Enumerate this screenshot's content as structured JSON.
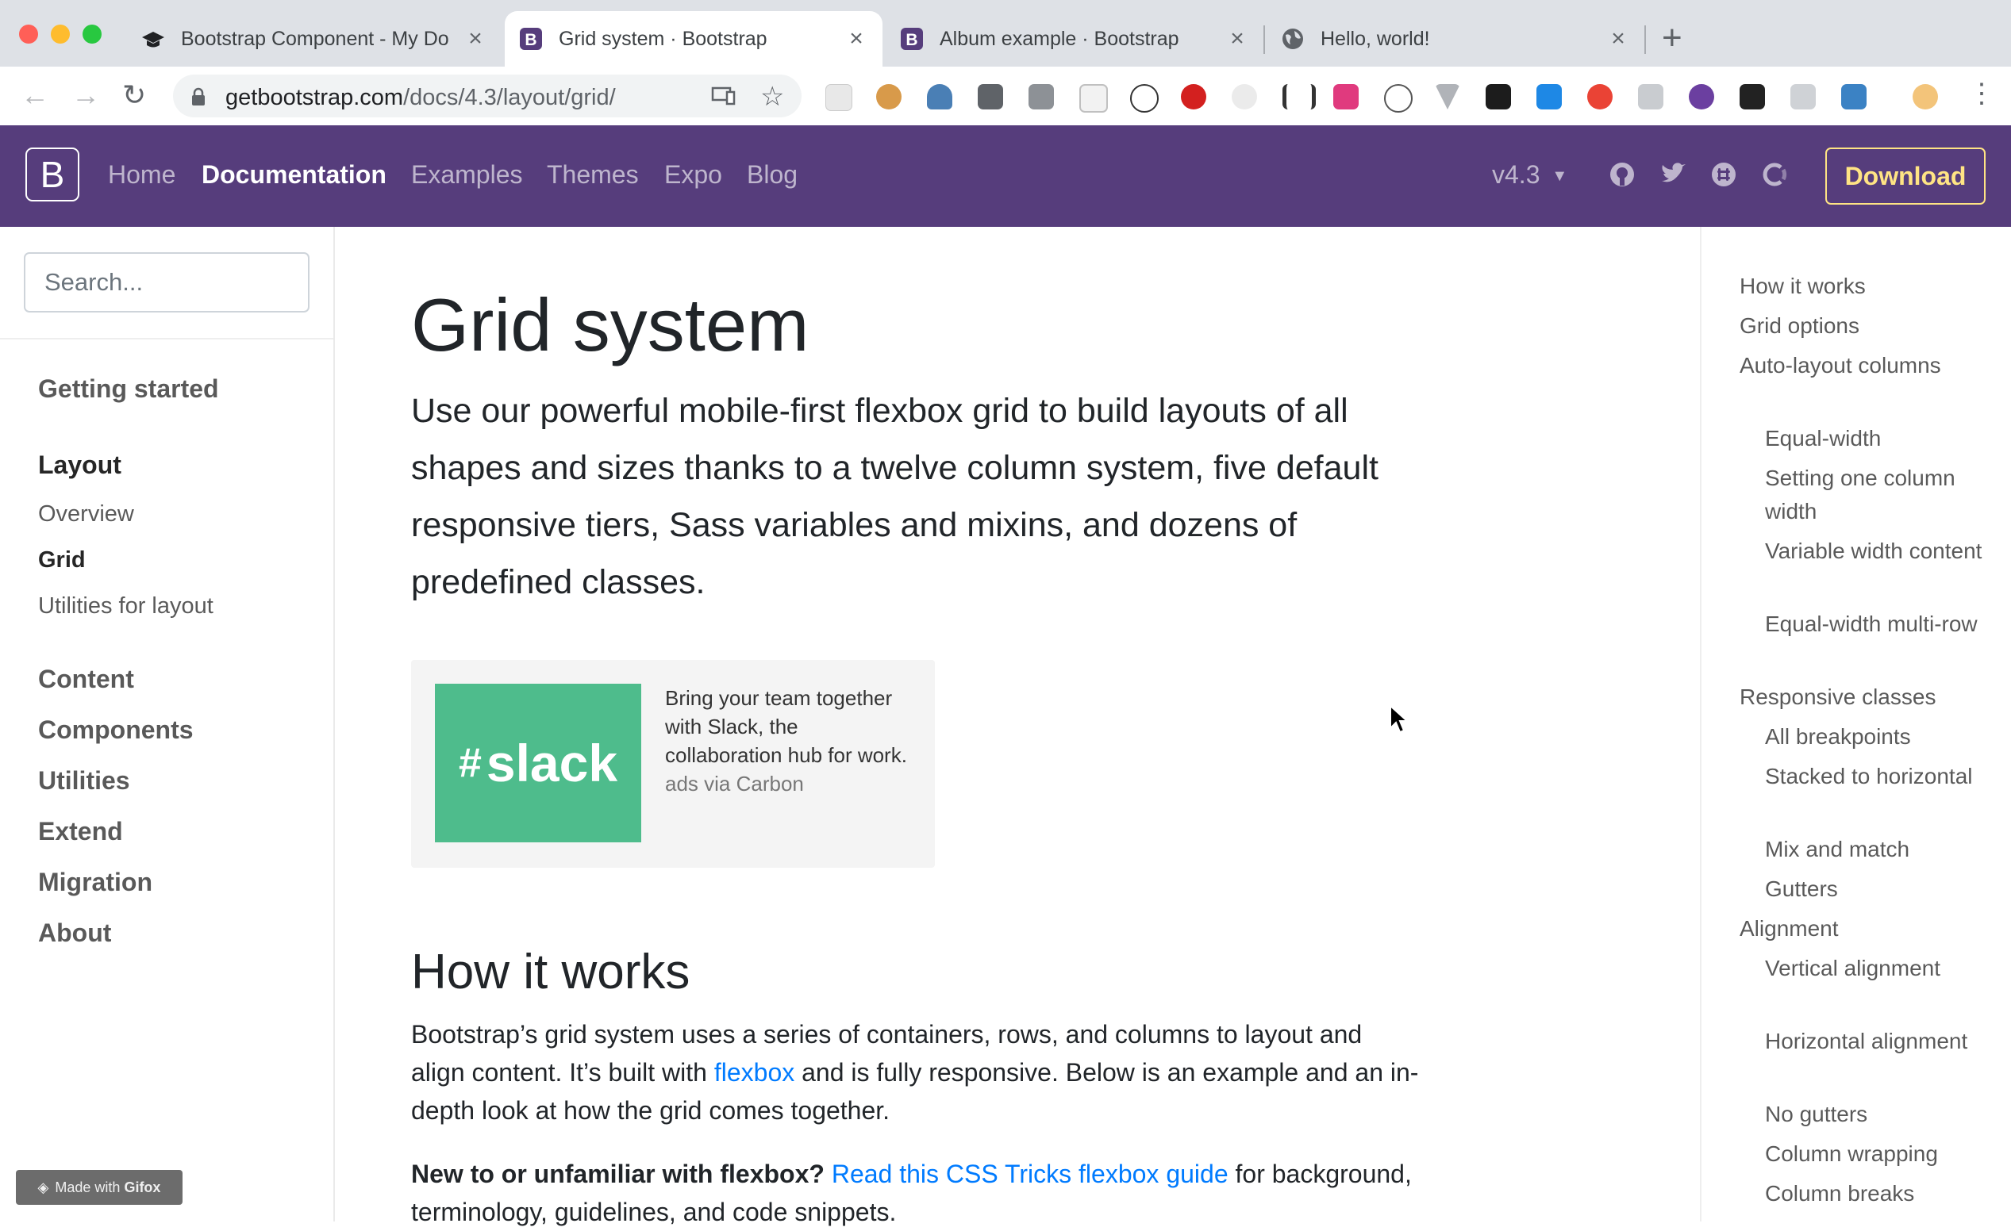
{
  "browser": {
    "tabs": [
      {
        "title": "Bootstrap Component - My Do",
        "icon": "graduation-cap-icon",
        "active": false
      },
      {
        "title": "Grid system · Bootstrap",
        "icon": "bootstrap-icon",
        "active": true
      },
      {
        "title": "Album example · Bootstrap",
        "icon": "bootstrap-icon",
        "active": false
      },
      {
        "title": "Hello, world!",
        "icon": "globe-icon",
        "active": false
      }
    ],
    "url_host": "getbootstrap.com",
    "url_path": "/docs/4.3/layout/grid/"
  },
  "navbar": {
    "brand": "B",
    "links": [
      "Home",
      "Documentation",
      "Examples",
      "Themes",
      "Expo",
      "Blog"
    ],
    "active_link": "Documentation",
    "version": "v4.3",
    "download": "Download"
  },
  "sidebar": {
    "search_placeholder": "Search...",
    "sections": [
      {
        "label": "Getting started"
      },
      {
        "label": "Layout",
        "active": true,
        "items": [
          {
            "label": "Overview"
          },
          {
            "label": "Grid",
            "active": true
          },
          {
            "label": "Utilities for layout"
          }
        ]
      },
      {
        "label": "Content"
      },
      {
        "label": "Components"
      },
      {
        "label": "Utilities"
      },
      {
        "label": "Extend"
      },
      {
        "label": "Migration"
      },
      {
        "label": "About"
      }
    ]
  },
  "main": {
    "title": "Grid system",
    "lead": "Use our powerful mobile-first flexbox grid to build layouts of all shapes and sizes thanks to a twelve column system, five default responsive tiers, Sass variables and mixins, and dozens of predefined classes.",
    "ad": {
      "logo_text": "slack",
      "text": "Bring your team together with Slack, the collaboration hub for work.",
      "via": "ads via Carbon"
    },
    "section_title": "How it works",
    "para1_a": "Bootstrap’s grid system uses a series of containers, rows, and columns to layout and align content. It’s built with ",
    "para1_link": "flexbox",
    "para1_b": " and is fully responsive. Below is an example and an in-depth look at how the grid comes together.",
    "para2_bold": "New to or unfamiliar with flexbox?",
    "para2_link": "Read this CSS Tricks flexbox guide",
    "para2_rest": " for background, terminology, guidelines, and code snippets."
  },
  "toc": [
    {
      "label": "How it works",
      "level": 1
    },
    {
      "label": "Grid options",
      "level": 1
    },
    {
      "label": "Auto-layout columns",
      "level": 1
    },
    {
      "label": "Equal-width",
      "level": 2
    },
    {
      "label": "Setting one column width",
      "level": 2
    },
    {
      "label": "Variable width content",
      "level": 2
    },
    {
      "label": "Equal-width multi-row",
      "level": 2
    },
    {
      "label": "Responsive classes",
      "level": 1
    },
    {
      "label": "All breakpoints",
      "level": 2
    },
    {
      "label": "Stacked to horizontal",
      "level": 2
    },
    {
      "label": "Mix and match",
      "level": 2
    },
    {
      "label": "Gutters",
      "level": 2
    },
    {
      "label": "Alignment",
      "level": 1
    },
    {
      "label": "Vertical alignment",
      "level": 2
    },
    {
      "label": "Horizontal alignment",
      "level": 2
    },
    {
      "label": "No gutters",
      "level": 2
    },
    {
      "label": "Column wrapping",
      "level": 2
    },
    {
      "label": "Column breaks",
      "level": 2
    }
  ],
  "watermark": {
    "prefix": "Made with",
    "brand": "Gifox"
  },
  "colors": {
    "navbar": "#563d7c",
    "download": "#ffe484",
    "link": "#007bff",
    "slack": "#4ebc8c"
  }
}
